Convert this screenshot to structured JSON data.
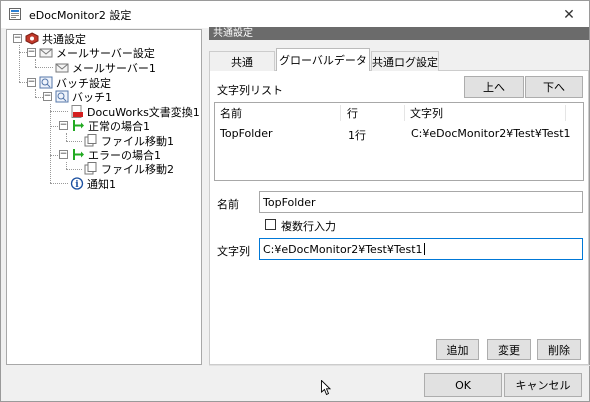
{
  "window": {
    "title": "eDocMonitor2 設定",
    "close_glyph": "✕"
  },
  "tree": {
    "root": "共通設定",
    "mail_settings": "メールサーバー設定",
    "mail_server1": "メールサーバー1",
    "batch_settings": "バッチ設定",
    "batch1": "バッチ1",
    "docuworks": "DocuWorks文書変換1",
    "normal_case": "正常の場合1",
    "file_move1": "ファイル移動1",
    "error_case": "エラーの場合1",
    "file_move2": "ファイル移動2",
    "notify1": "通知1"
  },
  "panel": {
    "header": "共通設定",
    "tabs": [
      "共通",
      "グローバルデータ",
      "共通ログ設定"
    ],
    "active_tab": "グローバルデータ",
    "list_title": "文字列リスト",
    "up_button": "上へ",
    "down_button": "下へ",
    "list_columns": [
      "名前",
      "行",
      "文字列"
    ],
    "list_rows": [
      {
        "name": "TopFolder",
        "lines": "1行",
        "value": "C:¥eDocMonitor2¥Test¥Test1"
      }
    ],
    "name_label": "名前",
    "name_value": "TopFolder",
    "multiline_label": "複数行入力",
    "string_label": "文字列",
    "string_value": "C:¥eDocMonitor2¥Test¥Test1",
    "add_button": "追加",
    "change_button": "変更",
    "delete_button": "削除"
  },
  "footer": {
    "ok": "OK",
    "cancel": "キャンセル"
  },
  "icons": {
    "app": "app-icon",
    "gear": "gear-icon",
    "mail": "mail-icon",
    "batch": "batch-icon",
    "pdf": "document-icon",
    "arrow": "branch-arrow-icon",
    "file": "file-icon",
    "info": "info-icon"
  },
  "colors": {
    "header_bg": "#6b6b6b",
    "focus_border": "#0078d7",
    "arrow_green": "#22aa22"
  }
}
